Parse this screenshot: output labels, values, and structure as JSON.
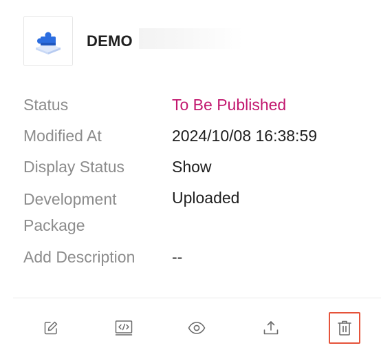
{
  "app": {
    "name": "DEMO",
    "logo_icon": "puzzle-piece-icon"
  },
  "details": [
    {
      "label": "Status",
      "value": "To Be Published"
    },
    {
      "label": "Modified At",
      "value": "2024/10/08 16:38:59"
    },
    {
      "label": "Display Status",
      "value": "Show"
    },
    {
      "label": "Development Package",
      "value": "Uploaded"
    },
    {
      "label": "Add Description",
      "value": "--"
    }
  ],
  "actions": [
    {
      "icon": "edit-icon"
    },
    {
      "icon": "code-icon"
    },
    {
      "icon": "eye-icon"
    },
    {
      "icon": "upload-icon"
    },
    {
      "icon": "trash-icon",
      "highlighted": true
    }
  ],
  "colors": {
    "status_accent": "#c2186f",
    "logo_blue": "#2b6de0",
    "highlight_border": "#e5533a"
  }
}
